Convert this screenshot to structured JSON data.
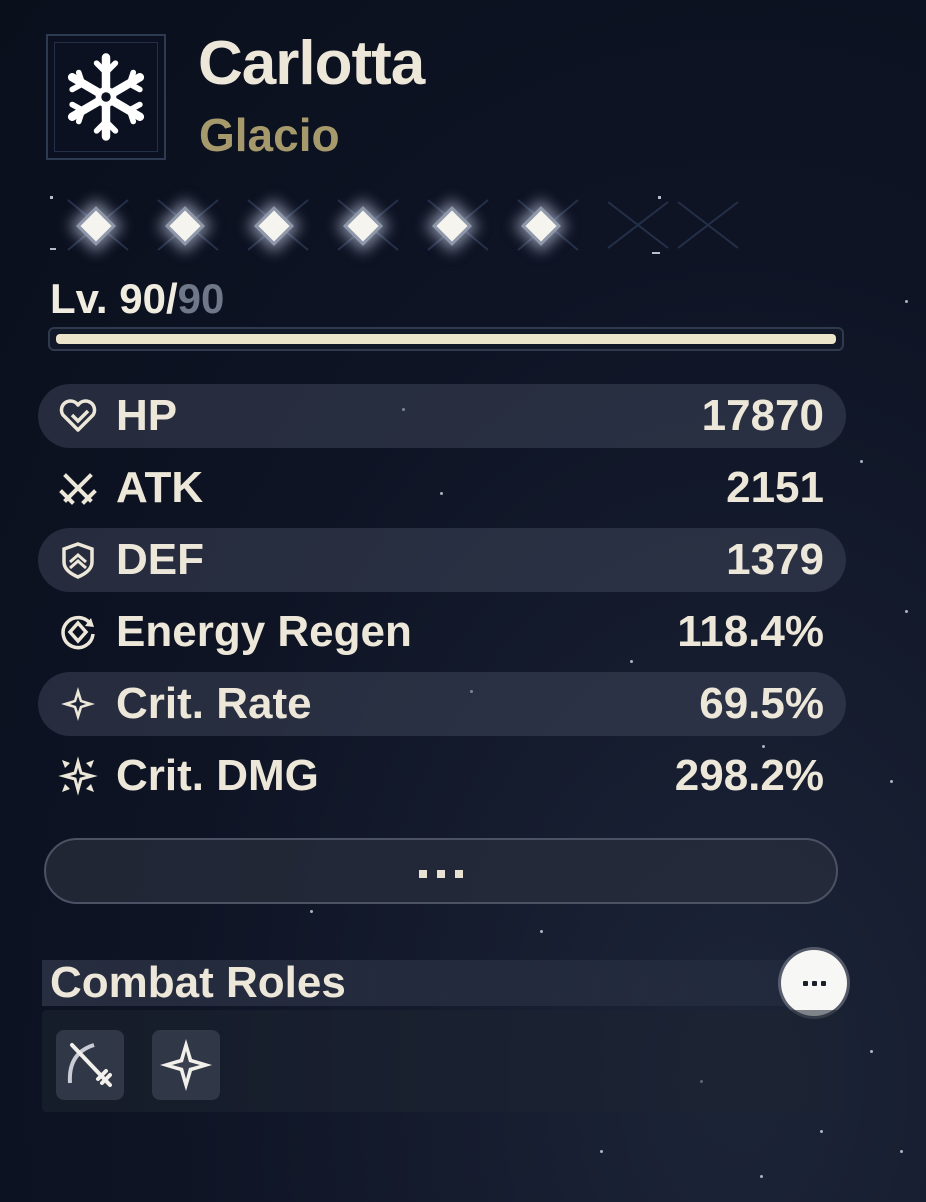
{
  "character": {
    "name": "Carlotta",
    "attribute": "Glacio",
    "attribute_color": "#a69a6c",
    "element_icon": "snowflake-icon"
  },
  "sequence": {
    "unlocked": 6,
    "total": 6
  },
  "level": {
    "prefix": "Lv.",
    "current": "90",
    "separator": "/",
    "max": "90",
    "progress": 1.0
  },
  "stats": [
    {
      "icon": "heart-hp-icon",
      "label": "HP",
      "value": "17870"
    },
    {
      "icon": "crossed-swords-icon",
      "label": "ATK",
      "value": "2151"
    },
    {
      "icon": "shield-icon",
      "label": "DEF",
      "value": "1379"
    },
    {
      "icon": "energy-regen-icon",
      "label": "Energy Regen",
      "value": "118.4%"
    },
    {
      "icon": "crit-star-icon",
      "label": "Crit. Rate",
      "value": "69.5%"
    },
    {
      "icon": "crit-burst-icon",
      "label": "Crit. DMG",
      "value": "298.2%"
    }
  ],
  "more_button": {
    "icon": "ellipsis-icon"
  },
  "combat_roles": {
    "title": "Combat Roles",
    "menu_icon": "more-options-icon",
    "roles": [
      {
        "icon": "sword-slash-icon"
      },
      {
        "icon": "four-point-star-icon"
      }
    ]
  }
}
